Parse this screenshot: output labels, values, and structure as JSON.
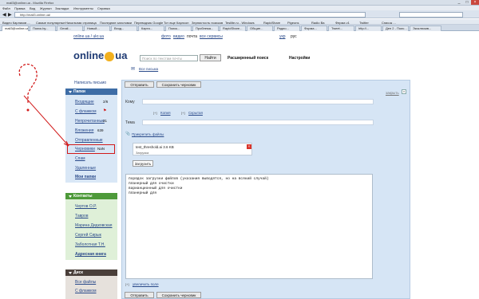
{
  "window": {
    "title": "mail3@online.ua - Mozilla Firefox",
    "controls": [
      "_",
      "□",
      "×"
    ]
  },
  "menu": [
    "Файл",
    "Правка",
    "Вид",
    "Журнал",
    "Закладки",
    "Инструменты",
    "Справка"
  ],
  "url": "http://mail3.online.ua/",
  "bookmarks": [
    "Видео Карликов ... ",
    "Самые популярные",
    "Начальная страница",
    "Последние заголовки",
    "Переводчик Google",
    "Тот еще Карлсон",
    "Зернистость поисков",
    "Tesilite.ru - Windows",
    "Пётр кар...",
    "Ночь Видео",
    "Гости Опен...",
    "Видео",
    "Проблемы",
    "RapidShare",
    "Pigeons",
    "Radio Ва",
    "Ферма v1",
    "Twitter",
    "Список ..."
  ],
  "tabs": [
    "mail3@online.ua",
    "Поиск.by...",
    "Gmail...",
    "Новый...",
    "Вход...",
    "Карта...",
    "Поиск...",
    "Проблема...",
    "RapidShare...",
    "Общие...",
    "Радио...",
    "Форма...",
    "Tweet...",
    "http://...",
    "Ден 2 - Поис...",
    "Эксклюзив..."
  ],
  "header": {
    "brand_text": "online",
    "brand_suffix": "ua",
    "domain_links": "online.ua / ukr.ua",
    "nav_links": [
      "фото",
      "видео",
      "почта",
      "все сервисы"
    ],
    "lang": [
      "укр",
      "рус"
    ],
    "search_placeholder": "Поиск по текстам почты",
    "find_button": "Найти",
    "advanced_search": "Расширенный поиск",
    "settings": "Настройки",
    "all_letters": "Все письма"
  },
  "sidebar": {
    "compose": "Написать письмо",
    "folders_title": "Папки",
    "folders": [
      {
        "label": "Входящие",
        "count": "2/6"
      },
      {
        "label": "С флажком",
        "count": ""
      },
      {
        "label": "Непрочитанные",
        "count": "21"
      },
      {
        "label": "Вложения",
        "count": "639"
      },
      {
        "label": "Отправленные",
        "count": ""
      },
      {
        "label": "Черновики",
        "count": "NaN"
      },
      {
        "label": "Спам",
        "count": ""
      },
      {
        "label": "Удаленные",
        "count": ""
      }
    ],
    "my_folders": "Мои папки",
    "contacts_title": "Контакты",
    "contacts": [
      "Чертов О.Р.",
      "Тавров",
      "Марина Дидковская",
      "Сергей Сирык",
      "Заболотная Т.Н."
    ],
    "address_book": "Адресная книга",
    "disk_title": "Диск",
    "disk_items": [
      "Все файлы",
      "С флажком"
    ]
  },
  "compose": {
    "send": "Отправить",
    "save_draft": "Сохранить черновик",
    "close": "закрыть",
    "to_label": "Кому",
    "copy_link": "Копия",
    "hidden_link": "Скрытая",
    "subject_label": "Тема",
    "attach_link": "Прикрепить файлы",
    "file_name": "test_threshold.ai 3.6 KB",
    "file_status": "Загрузка",
    "upload_button": "Загрузить",
    "body_lines": [
      "порядок загрузки файлов (указания выводятся, но на всякий случай)",
      "планерный для очистки",
      "варианционный для очистки",
      "планерный для"
    ],
    "enlarge": "увеличить поле"
  }
}
